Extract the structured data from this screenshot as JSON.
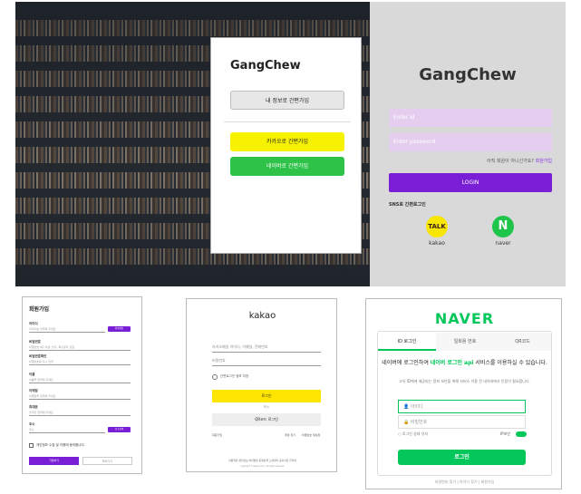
{
  "hero": {
    "modal": {
      "logo": "GangChew",
      "self_signup": "내 정보로 간편가입",
      "kakao_signup": "카카오로 간편가입",
      "naver_signup": "네이버로 간편가입"
    }
  },
  "login_panel": {
    "logo": "GangChew",
    "id_placeholder": "Enter id",
    "password_placeholder": "Enter password",
    "find_prefix": "아직 회원이 아니신가요?",
    "find_link": "회원가입",
    "login_label": "LOGIN",
    "sns_heading": "SNS로 간편로그인",
    "kakao_badge": "TALK",
    "kakao_label": "kakao",
    "naver_badge": "N",
    "naver_label": "naver"
  },
  "signup": {
    "title": "회원가입",
    "fields": [
      {
        "label": "아이디",
        "placeholder": "아이디를 입력해 주세요",
        "button": "중복확인"
      },
      {
        "label": "비밀번호",
        "placeholder": "비밀번호 8자 이상, 숫자, 특수문자 포함"
      },
      {
        "label": "비밀번호확인",
        "placeholder": "비밀번호를 다시 입력"
      },
      {
        "label": "이름",
        "placeholder": "이름을 입력해 주세요"
      },
      {
        "label": "이메일",
        "placeholder": "이메일을 입력해 주세요"
      },
      {
        "label": "휴대폰",
        "placeholder": "숫자만 입력해 주세요"
      },
      {
        "label": "주소",
        "placeholder": "주소",
        "button": "주소검색"
      }
    ],
    "agree": "개인정보 수집 및 이용에 동의합니다.",
    "submit": "가입하기",
    "cancel": "돌아가기"
  },
  "kakao": {
    "title": "kakao",
    "id_placeholder": "카카오메일 아이디, 이메일, 전화번호",
    "pw_placeholder": "비밀번호",
    "keep": "간편로그인 정보 저장",
    "login": "로그인",
    "or": "또는",
    "qr": "QR코드 로그인",
    "signup": "회원가입",
    "find_id": "계정 찾기",
    "find_pw": "비밀번호 재설정",
    "footer": "이용약관  개인정보 처리방침  운영정책  고객센터  공지사항  한국어",
    "copyright": "Copyright © Kakao Corp. All rights reserved."
  },
  "naver": {
    "title": "NAVER",
    "tab_id": "ID 로그인",
    "tab_phone": "일회용 번호",
    "tab_qr": "QR코드",
    "desc_prefix": "네이버에 로그인하여 ",
    "desc_highlight": "네이버 로그인 api",
    "desc_suffix": " 서비스를 이용하실 수 있습니다.",
    "desc_note": "고유 ID에게 제공되는 정보 보안을 위해 서비스 이용 전 네이버에서 인증이 필요합니다.",
    "id_placeholder": "아이디",
    "pw_placeholder": "비밀번호",
    "keep": "로그인 상태 유지",
    "ip": "IP보안",
    "login": "로그인",
    "bottom": "비밀번호 찾기  |  아이디 찾기  |  회원가입"
  }
}
